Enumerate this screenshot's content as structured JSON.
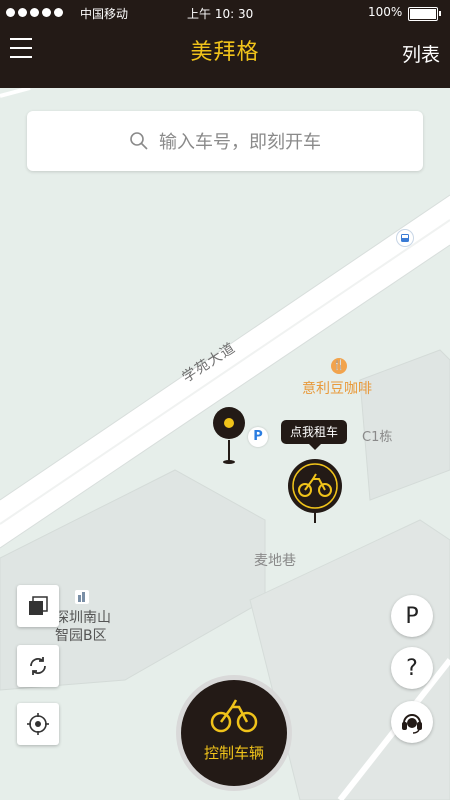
{
  "status_bar": {
    "carrier": "中国移动",
    "time": "上午 10: 30",
    "battery": "100%"
  },
  "nav": {
    "title": "美拜格",
    "list_label": "列表"
  },
  "search": {
    "placeholder": "输入车号，即刻开车"
  },
  "map": {
    "road_name": "学苑大道",
    "poi_cafe": "意利豆咖啡",
    "building_c1": "C1栋",
    "lane": "麦地巷",
    "park_line1": "深圳南山",
    "park_line2": "智园B区"
  },
  "bike_tooltip": "点我租车",
  "controls": {
    "parking_label": "P",
    "help_label": "?",
    "control_vehicle_label": "控制车辆"
  },
  "colors": {
    "brand_dark": "#231a16",
    "brand_yellow": "#f0c31a",
    "poi_orange": "#e89a3c"
  }
}
